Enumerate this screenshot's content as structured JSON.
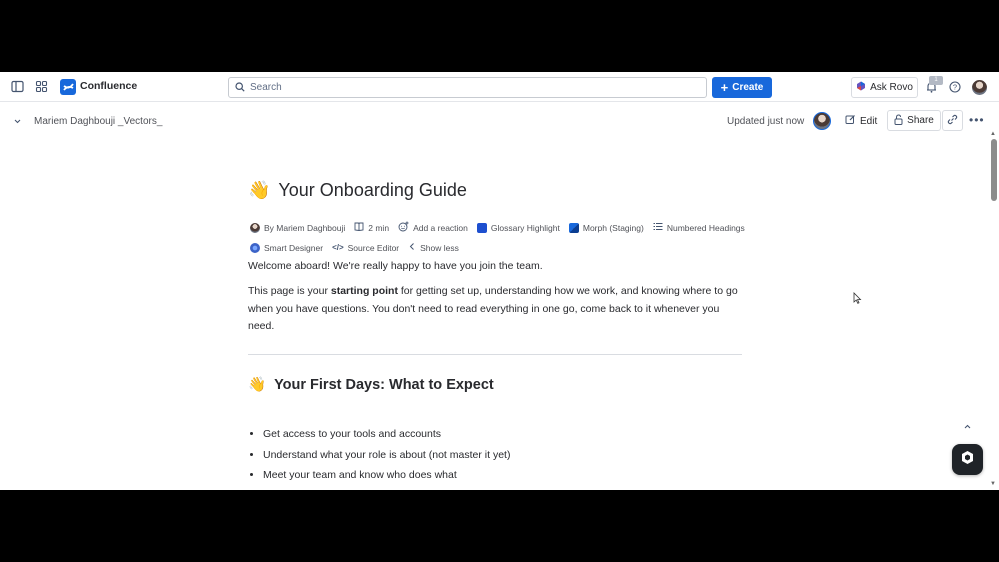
{
  "topnav": {
    "app_name": "Confluence",
    "search_placeholder": "Search",
    "create_label": "Create",
    "ask_rovo_label": "Ask Rovo",
    "notification_count": "1"
  },
  "pagebar": {
    "space_name": "Mariem Daghbouji _Vectors_",
    "updated_text": "Updated just now",
    "edit_label": "Edit",
    "share_label": "Share"
  },
  "page": {
    "title_emoji": "👋",
    "title": "Your Onboarding Guide",
    "meta_row1": {
      "author": "By Mariem Daghbouji",
      "read_time": "2 min",
      "reaction": "Add a reaction",
      "app1": "Glossary Highlight",
      "app2": "Morph (Staging)",
      "app3": "Numbered Headings"
    },
    "meta_row2": {
      "app4": "Smart Designer",
      "app5": "Source Editor",
      "show_less": "Show less"
    },
    "welcome": "Welcome aboard! We're really happy to have you join the team.",
    "intro_before": "This page is your ",
    "intro_bold": "starting point",
    "intro_after": " for getting set up, understanding how we work, and knowing where to go when you have questions. You don't need to read everything in one go, come back to it whenever you need.",
    "section_emoji": "👋",
    "section_title": "Your First Days: What to Expect",
    "bullets": [
      "Get access to your tools and accounts",
      "Understand what your role is about (not master it yet)",
      "Meet your team and know who does what"
    ]
  },
  "colors": {
    "primary": "#1868db",
    "text": "#292a2e",
    "subtle": "#505258"
  }
}
